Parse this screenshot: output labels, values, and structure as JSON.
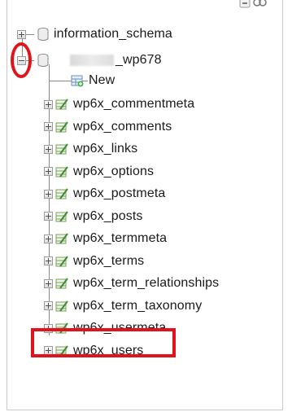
{
  "tree": {
    "databases": [
      {
        "name": "information_schema",
        "expanded": false
      },
      {
        "name_suffix": "_wp678",
        "expanded": true,
        "name_prefix_obscured": true
      }
    ],
    "new_label": "New",
    "tables": [
      "wp6x_commentmeta",
      "wp6x_comments",
      "wp6x_links",
      "wp6x_options",
      "wp6x_postmeta",
      "wp6x_posts",
      "wp6x_termmeta",
      "wp6x_terms",
      "wp6x_term_relationships",
      "wp6x_term_taxonomy",
      "wp6x_usermeta",
      "wp6x_users"
    ]
  },
  "highlights": {
    "color": "#e0141c",
    "circled": "collapse toggle of _wp678",
    "boxed": "wp6x_users"
  },
  "icons": {
    "database": "database-icon",
    "table": "table-icon",
    "new": "new-table-icon",
    "expand": "plus-icon",
    "collapse": "minus-icon"
  }
}
